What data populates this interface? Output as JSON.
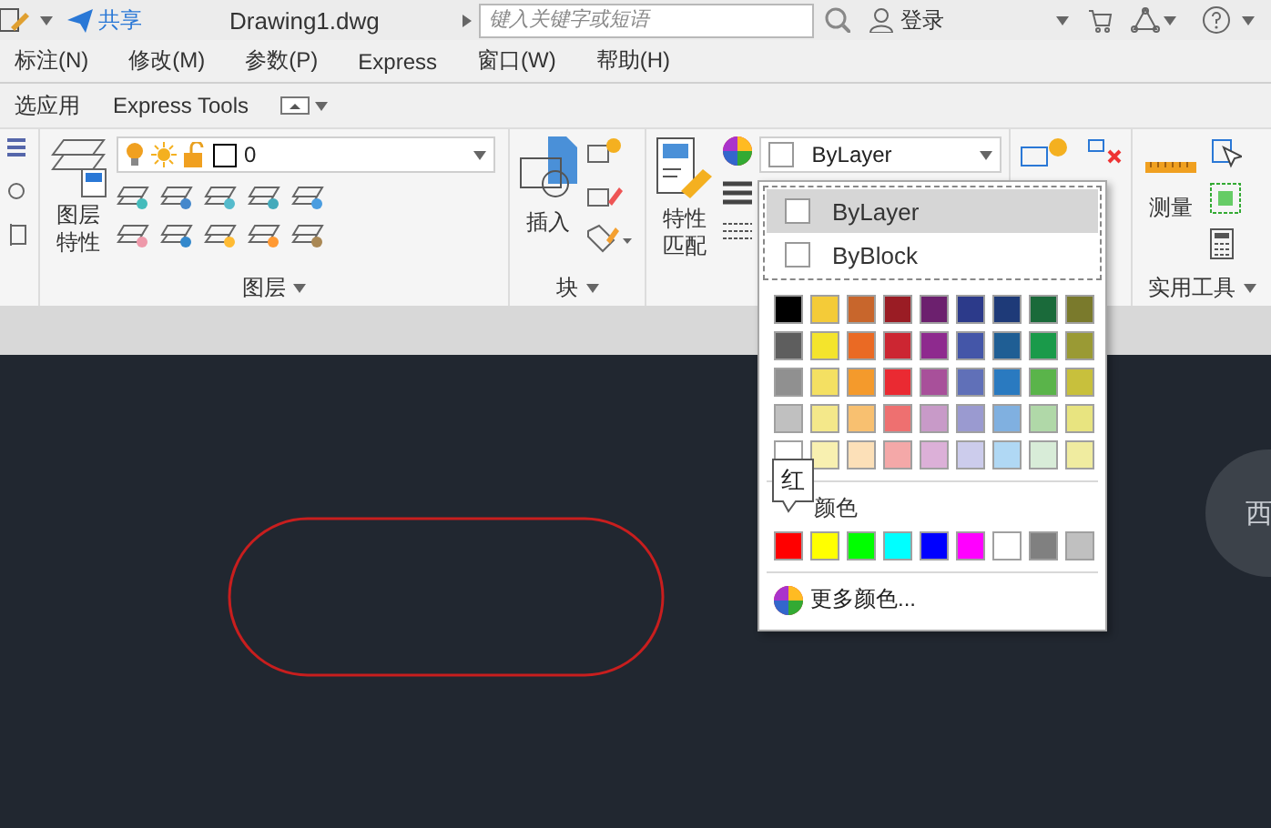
{
  "title_bar": {
    "share": "共享",
    "document": "Drawing1.dwg",
    "search": {
      "placeholder": "键入关键字或短语"
    },
    "login": "登录"
  },
  "menu": [
    {
      "label": "标注(N)"
    },
    {
      "label": "修改(M)"
    },
    {
      "label": "参数(P)"
    },
    {
      "label": "Express"
    },
    {
      "label": "窗口(W)"
    },
    {
      "label": "帮助(H)"
    }
  ],
  "ribbon_tabs": [
    {
      "label": "选应用",
      "selected": false
    },
    {
      "label": "Express Tools",
      "selected": false
    }
  ],
  "ribbon": {
    "layers": {
      "title": "图层",
      "properties_button": "图层特性",
      "current_layer": "0"
    },
    "block": {
      "title": "块",
      "insert_button": "插入"
    },
    "properties": {
      "match_button": "特性匹配",
      "color_value": "ByLayer"
    },
    "utilities": {
      "title": "实用工具",
      "measure_button": "测量"
    }
  },
  "color_menu": {
    "options": [
      {
        "label": "ByLayer",
        "selected": true
      },
      {
        "label": "ByBlock",
        "selected": false
      }
    ],
    "palette": [
      [
        {
          "color": "#000000"
        },
        {
          "color": "#f4cb38"
        },
        {
          "color": "#c8662c"
        },
        {
          "color": "#9a1c24"
        },
        {
          "color": "#6c206e"
        },
        {
          "color": "#2c3a8a"
        },
        {
          "color": "#1e3a78"
        },
        {
          "color": "#1a6a3a"
        },
        {
          "color": "#7a7a2c"
        }
      ],
      [
        {
          "color": "#5e5e5e"
        },
        {
          "color": "#f4e42c"
        },
        {
          "color": "#ea6a24"
        },
        {
          "color": "#cc2632"
        },
        {
          "color": "#8e2a8e"
        },
        {
          "color": "#4456a8"
        },
        {
          "color": "#1f5e94"
        },
        {
          "color": "#1a9a4a"
        },
        {
          "color": "#9a9a34"
        }
      ],
      [
        {
          "color": "#909090"
        },
        {
          "color": "#f4e062"
        },
        {
          "color": "#f49a2c"
        },
        {
          "color": "#ea2a32"
        },
        {
          "color": "#a8509a"
        },
        {
          "color": "#6070b8"
        },
        {
          "color": "#2a7ac0"
        },
        {
          "color": "#5ab44a"
        },
        {
          "color": "#c8c03c"
        }
      ],
      [
        {
          "color": "#c0c0c0"
        },
        {
          "color": "#f4e88a"
        },
        {
          "color": "#f8c070"
        },
        {
          "color": "#ee7070"
        },
        {
          "color": "#c89ac8"
        },
        {
          "color": "#9a9ad0"
        },
        {
          "color": "#80b0e0"
        },
        {
          "color": "#b0d8a8"
        },
        {
          "color": "#e8e480"
        }
      ],
      [
        {
          "color": "#ffffff"
        },
        {
          "color": "#f8f0b0"
        },
        {
          "color": "#fce0b8"
        },
        {
          "color": "#f4a8a8"
        },
        {
          "color": "#dcb0d8"
        },
        {
          "color": "#ccccec"
        },
        {
          "color": "#b0d8f4"
        },
        {
          "color": "#d8ecd8"
        },
        {
          "color": "#f0eca0"
        }
      ]
    ],
    "standard_label": "颜色",
    "standard_colors": [
      {
        "color": "#ff0000"
      },
      {
        "color": "#ffff00"
      },
      {
        "color": "#00ff00"
      },
      {
        "color": "#00ffff"
      },
      {
        "color": "#0000ff"
      },
      {
        "color": "#ff00ff"
      },
      {
        "color": "#ffffff"
      },
      {
        "color": "#808080"
      },
      {
        "color": "#c0c0c0"
      }
    ],
    "more_colors": "更多颜色...",
    "tooltip": "红"
  },
  "view_cube": {
    "label": "西"
  }
}
